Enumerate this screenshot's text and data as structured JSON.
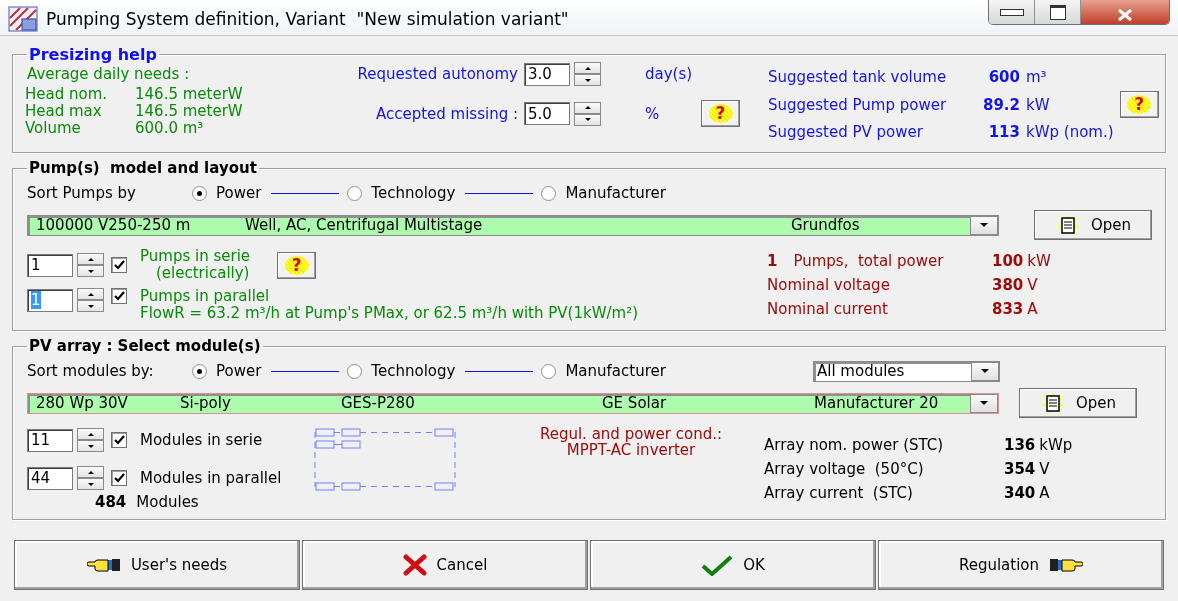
{
  "window": {
    "title": "Pumping System definition, Variant  \"New simulation variant\""
  },
  "presizing": {
    "title": "Presizing help",
    "needs_heading": "Average daily needs :",
    "needs": [
      {
        "label": "Head nom.",
        "value": "146.5 meterW"
      },
      {
        "label": "Head max",
        "value": "146.5 meterW"
      },
      {
        "label": "Volume",
        "value": "600.0 m³"
      }
    ],
    "autonomy": {
      "label": "Requested autonomy",
      "value": "3.0",
      "unit": "day(s)"
    },
    "missing": {
      "label": "Accepted missing :",
      "value": "5.0",
      "unit": "%",
      "help": "?"
    },
    "suggestions": [
      {
        "label": "Suggested tank volume",
        "value": "600",
        "unit": "m³"
      },
      {
        "label": "Suggested Pump power",
        "value": "89.2",
        "unit": "kW"
      },
      {
        "label": "Suggested PV power",
        "value": "113",
        "unit": "kWp (nom.)"
      }
    ],
    "suggestions_help": "?"
  },
  "pumps": {
    "title": "Pump(s)  model and layout",
    "sort_label": "Sort Pumps by",
    "sort_options": [
      {
        "label": "Power",
        "selected": true
      },
      {
        "label": "Technology",
        "selected": false
      },
      {
        "label": "Manufacturer",
        "selected": false
      }
    ],
    "model": [
      "100000 V250-250 m",
      "Well, AC, Centrifugal Multistage",
      "Grundfos"
    ],
    "open_button": "Open",
    "serie": {
      "value": "1",
      "checked": true,
      "label": "Pumps in serie",
      "note": "(electrically)",
      "help": "?"
    },
    "parallel": {
      "value": "1",
      "text_selected": true,
      "checked": true,
      "label": "Pumps in parallel"
    },
    "flow": "FlowR = 63.2 m³/h at Pump's PMax, or 62.5 m³/h with PV(1kW/m²)",
    "summary": [
      {
        "count": "1",
        "label": "Pumps,  total power",
        "value": "100",
        "unit": "kW"
      },
      {
        "label": "Nominal voltage",
        "value": "380",
        "unit": "V"
      },
      {
        "label": "Nominal current",
        "value": "833",
        "unit": "A"
      }
    ]
  },
  "pv": {
    "title": "PV array : Select module(s)",
    "sort_label": "Sort modules by:",
    "sort_options": [
      {
        "label": "Power",
        "selected": true
      },
      {
        "label": "Technology",
        "selected": false
      },
      {
        "label": "Manufacturer",
        "selected": false
      }
    ],
    "filter": "All modules",
    "model": [
      "280 Wp 30V",
      "Si-poly",
      "GES-P280",
      "GE Solar",
      "Manufacturer 20"
    ],
    "open_button": "Open",
    "serie": {
      "value": "11",
      "checked": true,
      "label": "Modules in serie"
    },
    "parallel": {
      "value": "44",
      "checked": true,
      "label": "Modules in parallel"
    },
    "total": {
      "value": "484",
      "label": "Modules"
    },
    "regulation": "Regul. and power cond.:\nMPPT-AC inverter",
    "array": [
      {
        "label": "Array nom. power (STC)",
        "value": "136",
        "unit": "kWp"
      },
      {
        "label": "Array voltage  (50°C)",
        "value": "354",
        "unit": "V"
      },
      {
        "label": "Array current  (STC)",
        "value": "340",
        "unit": "A"
      }
    ]
  },
  "buttons": [
    {
      "kind": "users_needs",
      "label": "User's needs"
    },
    {
      "kind": "cancel",
      "label": "Cancel"
    },
    {
      "kind": "ok",
      "label": "OK"
    },
    {
      "kind": "regulation",
      "label": "Regulation"
    }
  ]
}
